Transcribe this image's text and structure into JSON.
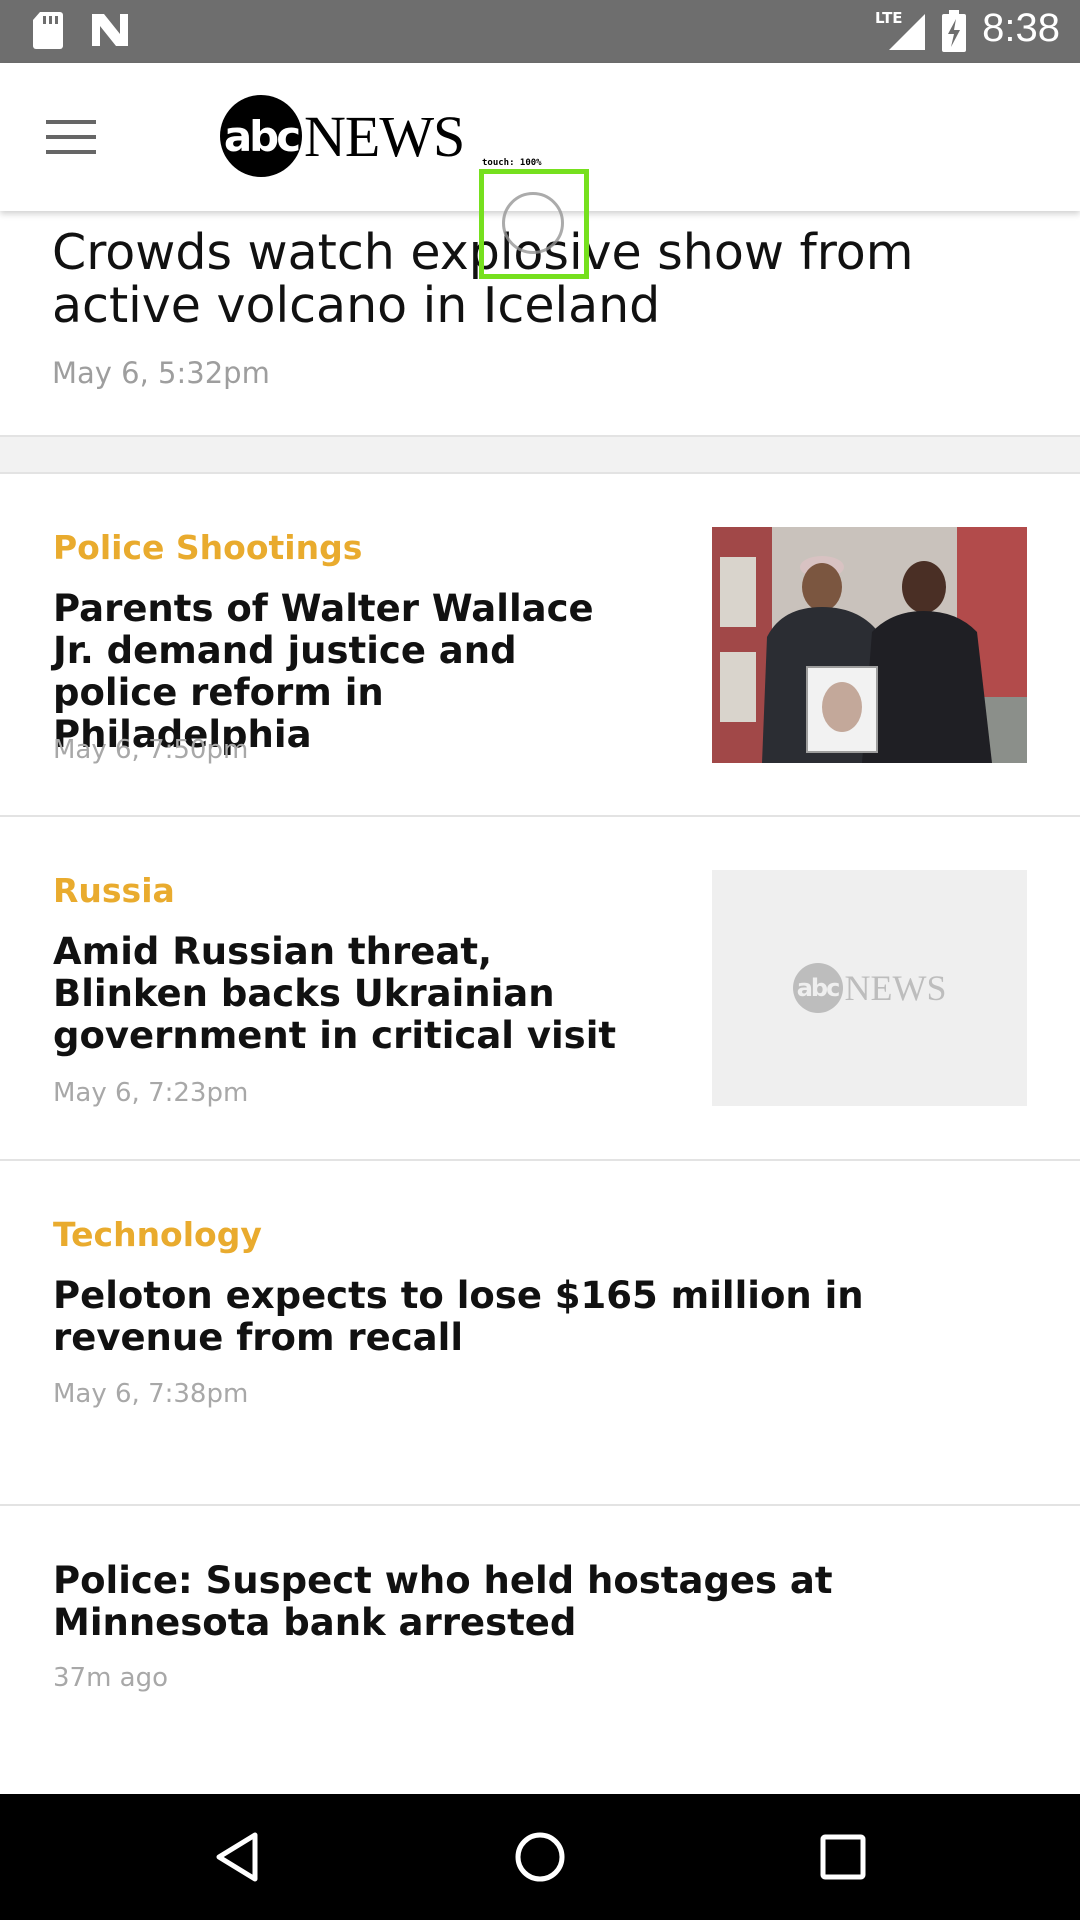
{
  "status_bar": {
    "time": "8:38",
    "network": "LTE",
    "icons": [
      "sd-card-icon",
      "notification-n-icon",
      "lte-signal-icon",
      "battery-charging-icon"
    ]
  },
  "app_bar": {
    "menu_icon": "hamburger-menu-icon",
    "logo_abc": "abc",
    "logo_news": "NEWS"
  },
  "touch_overlay": {
    "label": "touch: 100%"
  },
  "hero": {
    "title": "Crowds watch explosive show from active volcano in Iceland",
    "time": "May 6, 5:32pm"
  },
  "articles": [
    {
      "category": "Police Shootings",
      "headline": "Parents of Walter Wallace Jr. demand justice and police reform in Philadelphia",
      "time": "May 6, 7:50pm"
    },
    {
      "category": "Russia",
      "headline": "Amid Russian threat, Blinken backs Ukrainian government in critical visit",
      "time": "May 6, 7:23pm",
      "placeholder_abc": "abc",
      "placeholder_news": "NEWS"
    },
    {
      "category": "Technology",
      "headline": "Peloton expects to lose $165 million in revenue from recall",
      "time": "May 6, 7:38pm"
    },
    {
      "headline": "Police: Suspect who held hostages at Minnesota bank arrested",
      "time": "37m ago"
    }
  ],
  "colors": {
    "category_accent": "#e9ab2e",
    "status_bar": "#6e6e6e",
    "touch_box": "#76e01e"
  },
  "nav_bar": {
    "icons": [
      "back-icon",
      "home-icon",
      "recents-icon"
    ]
  }
}
